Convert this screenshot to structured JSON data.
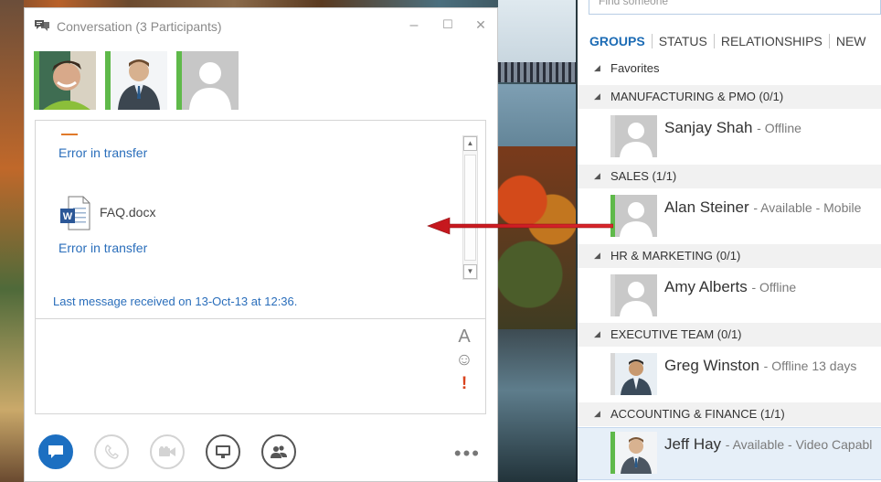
{
  "conversation": {
    "title": "Conversation (3 Participants)",
    "controls": {
      "minimize": "–",
      "maximize": "☐",
      "close": "✕"
    },
    "participants": [
      {
        "name": "participant-1",
        "presence": "available",
        "avatar": "photo-man-smiling"
      },
      {
        "name": "participant-2",
        "presence": "available",
        "avatar": "photo-man-suit"
      },
      {
        "name": "participant-3",
        "presence": "available",
        "avatar": "placeholder-silhouette"
      }
    ],
    "messages": {
      "error1": "Error in transfer",
      "file_name": "FAQ.docx",
      "error2": "Error in transfer",
      "last_message": "Last message received on 13-Oct-13 at 12:36."
    },
    "compose_tools": {
      "font": "A",
      "emoticon": "☺",
      "important": "!"
    },
    "bottom_buttons": [
      "im-icon",
      "phone-icon",
      "video-icon",
      "present-icon",
      "participants-icon"
    ],
    "more": "•••",
    "colors": {
      "presence_available": "#5fb94a",
      "link": "#2a6ebb",
      "im_button": "#1c6fc1"
    }
  },
  "contacts": {
    "search_placeholder": "Find someone",
    "tabs": [
      "GROUPS",
      "STATUS",
      "RELATIONSHIPS",
      "NEW"
    ],
    "groups": [
      {
        "name": "Favorites",
        "contacts": []
      },
      {
        "name": "MANUFACTURING & PMO (0/1)",
        "contacts": [
          {
            "name": "Sanjay Shah",
            "status": "- Offline",
            "presence": "offline",
            "avatar": "silhouette"
          }
        ]
      },
      {
        "name": "SALES (1/1)",
        "contacts": [
          {
            "name": "Alan Steiner",
            "status": "- Available - Mobile",
            "presence": "available",
            "avatar": "silhouette"
          }
        ]
      },
      {
        "name": "HR & MARKETING (0/1)",
        "contacts": [
          {
            "name": "Amy Alberts",
            "status": "- Offline",
            "presence": "offline",
            "avatar": "silhouette"
          }
        ]
      },
      {
        "name": "EXECUTIVE TEAM (0/1)",
        "contacts": [
          {
            "name": "Greg Winston",
            "status": "- Offline 13 days",
            "presence": "offline",
            "avatar": "photo"
          }
        ]
      },
      {
        "name": "ACCOUNTING & FINANCE (1/1)",
        "contacts": [
          {
            "name": "Jeff Hay",
            "status": "- Available - Video Capabl",
            "presence": "available",
            "avatar": "photo"
          }
        ]
      }
    ]
  }
}
